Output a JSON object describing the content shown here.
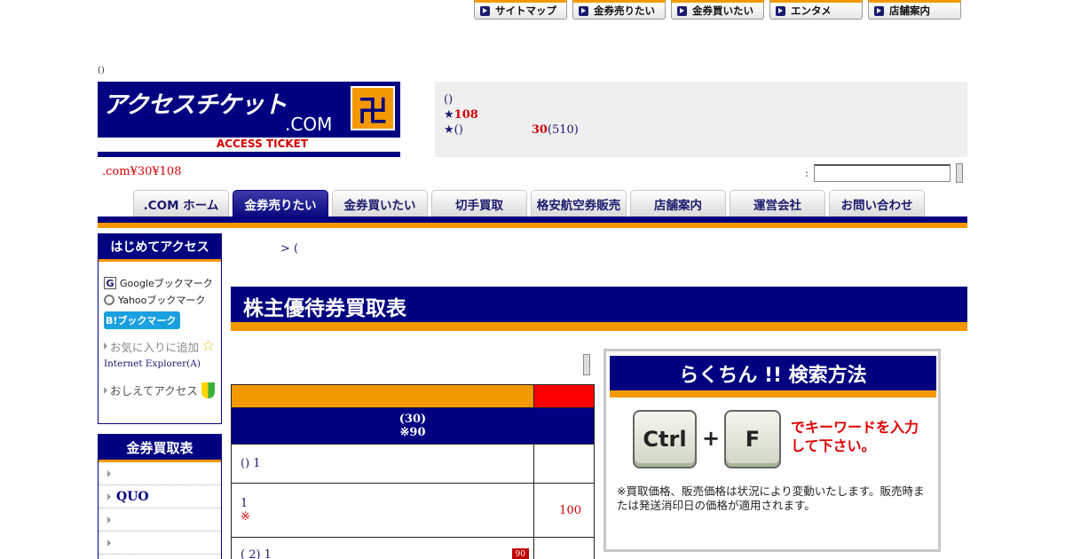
{
  "top_nav": [
    "サイトマップ",
    "金券売りたい",
    "金券買いたい",
    "エンタメ",
    "店舗案内"
  ],
  "paren_mark": "()",
  "logo": {
    "main_text": "アクセスチケット",
    "com_text": ".COM",
    "emblem": "卍",
    "sub_text": "ACCESS TICKET"
  },
  "info": {
    "line1": "()",
    "line2_prefix": "★",
    "line2_red": "108",
    "line3_prefix": "★()",
    "line3_red": "30",
    "line3_rest": "(510)"
  },
  "promo": ".com¥30¥108",
  "search": {
    "colon": ":",
    "value": ""
  },
  "main_nav": [
    ".COM ホーム",
    "金券売りたい",
    "金券買いたい",
    "切手買取",
    "格安航空券販売",
    "店舗案内",
    "運営会社",
    "お問い合わせ"
  ],
  "main_nav_active": 1,
  "sidebar": {
    "hajime_title": "はじめてアクセス",
    "google_bm": "Googleブックマーク",
    "google_icon": "G",
    "yahoo_bm": "Yahooブックマーク",
    "yahoo_icon": "Y",
    "hatena_bm": "B!ブックマーク",
    "fav": "お気に入りに追加",
    "star_icon": "☆",
    "ie": "Internet Explorer(A)",
    "oshiete": "おしえてアクセス",
    "kaitori_title": "金券買取表",
    "kaitori_items": [
      "",
      "QUO",
      "",
      "",
      ""
    ]
  },
  "breadcrumb": "> (",
  "page_title": "株主優待券買取表",
  "table": {
    "header_line1": "(30)",
    "header_line2": "※90",
    "rows": [
      {
        "name": "() 1",
        "note": "",
        "price": "",
        "badge": ""
      },
      {
        "name": "1",
        "note": "※",
        "price": "100",
        "badge": ""
      },
      {
        "name": "( 2) 1",
        "note": "",
        "price": "",
        "badge": "90"
      }
    ]
  },
  "guide": {
    "title": "らくちん !! 検索方法",
    "key1": "Ctrl",
    "plus": "+",
    "key2": "F",
    "instruction": "でキーワードを入力して下さい。",
    "note": "※買取価格、販売価格は状況により変動いたします。販売時または発送消印日の価格が適用されます。"
  },
  "colors": {
    "navy": "#000080",
    "orange": "#f39800",
    "red": "#d40000"
  }
}
